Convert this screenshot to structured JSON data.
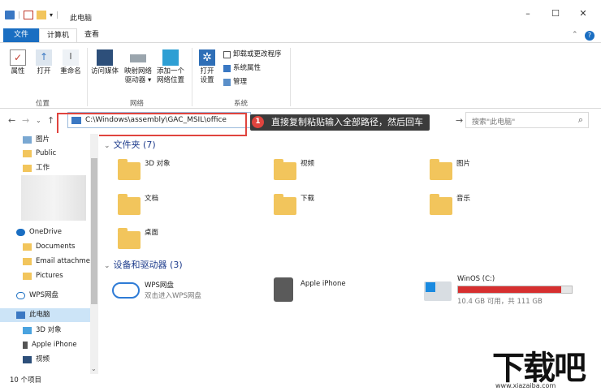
{
  "window": {
    "title": "此电脑",
    "min": "–",
    "max": "☐",
    "close": "✕",
    "up": "⌃"
  },
  "tabs": {
    "file": "文件",
    "computer": "计算机",
    "view": "查看"
  },
  "ribbon": {
    "properties": "属性",
    "open": "打开",
    "rename": "重命名",
    "media": "访问媒体",
    "mapdrive": "映射网络",
    "mapdrive2": "驱动器 ▾",
    "addloc": "添加一个",
    "addloc2": "网络位置",
    "opensettings": "打开",
    "opensettings2": "设置",
    "uninstall": "卸载或更改程序",
    "sysprops": "系统属性",
    "manage": "管理",
    "group_location": "位置",
    "group_network": "网络",
    "group_system": "系统"
  },
  "address": {
    "path": "C:\\Windows\\assembly\\GAC_MSIL\\office",
    "search_placeholder": "搜索\"此电脑\""
  },
  "tooltip": {
    "num": "1",
    "text": "直接复制粘贴输入全部路径，然后回车"
  },
  "sidebar": {
    "items": [
      "图片",
      "Public",
      "工作",
      "OneDrive",
      "Documents",
      "Email attachme",
      "Pictures",
      "WPS网盘",
      "此电脑",
      "3D 对象",
      "Apple iPhone",
      "视频"
    ]
  },
  "folders": {
    "header": "文件夹 (7)",
    "items": [
      "3D 对象",
      "视频",
      "图片",
      "文档",
      "下载",
      "音乐",
      "桌面"
    ]
  },
  "devices": {
    "header": "设备和驱动器 (3)",
    "wps": "WPS网盘",
    "wps_sub": "双击进入WPS网盘",
    "iphone": "Apple iPhone",
    "drive": "WinOS (C:)",
    "drive_free": "10.4 GB 可用，共 111 GB",
    "drive_used_fraction": 0.906
  },
  "status": {
    "count": "10 个项目"
  },
  "watermark": {
    "text": "下载吧",
    "url": "www.xiazaiba.com"
  }
}
